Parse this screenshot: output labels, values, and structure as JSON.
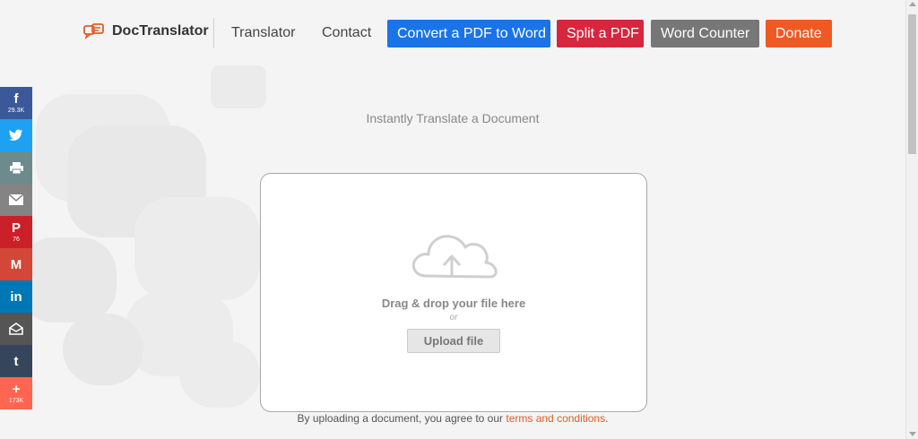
{
  "header": {
    "logo": {
      "bold": "Doc",
      "rest": "Translator"
    },
    "nav": [
      {
        "label": "Translator"
      },
      {
        "label": "Contact"
      }
    ],
    "buttons": [
      {
        "label": "Convert a PDF to Word",
        "color": "#1a73e8"
      },
      {
        "label": "Split a PDF",
        "color": "#d7263d"
      },
      {
        "label": "Word Counter",
        "color": "#777777"
      },
      {
        "label": "Donate",
        "color": "#ef5a24"
      }
    ]
  },
  "social": [
    {
      "icon": "facebook-icon",
      "glyph": "f",
      "count": "29.3K",
      "color": "#3b5998"
    },
    {
      "icon": "twitter-icon",
      "glyph": "🐦",
      "count": "",
      "color": "#1da1f2"
    },
    {
      "icon": "print-icon",
      "glyph": "⎙",
      "count": "",
      "color": "#6d8a8c"
    },
    {
      "icon": "email-icon",
      "glyph": "✉",
      "count": "",
      "color": "#848484"
    },
    {
      "icon": "pinterest-icon",
      "glyph": "P",
      "count": "76",
      "color": "#cb2027"
    },
    {
      "icon": "gmail-icon",
      "glyph": "M",
      "count": "",
      "color": "#d44638"
    },
    {
      "icon": "linkedin-icon",
      "glyph": "in",
      "count": "",
      "color": "#0077b5"
    },
    {
      "icon": "mailbox-icon",
      "glyph": "✉",
      "count": "",
      "color": "#555555"
    },
    {
      "icon": "tumblr-icon",
      "glyph": "t",
      "count": "",
      "color": "#35465c"
    },
    {
      "icon": "more-icon",
      "glyph": "+",
      "count": "173K",
      "color": "#ff6550"
    }
  ],
  "main": {
    "tagline": "Instantly Translate a Document",
    "drop_text": "Drag & drop your file here",
    "or_text": "or",
    "upload_label": "Upload file",
    "terms_prefix": "By uploading a document, you agree to our",
    "terms_link": "terms and conditions",
    "terms_suffix": "."
  },
  "colors": {
    "accent_orange": "#e25b2b",
    "background": "#f4f4f4"
  }
}
